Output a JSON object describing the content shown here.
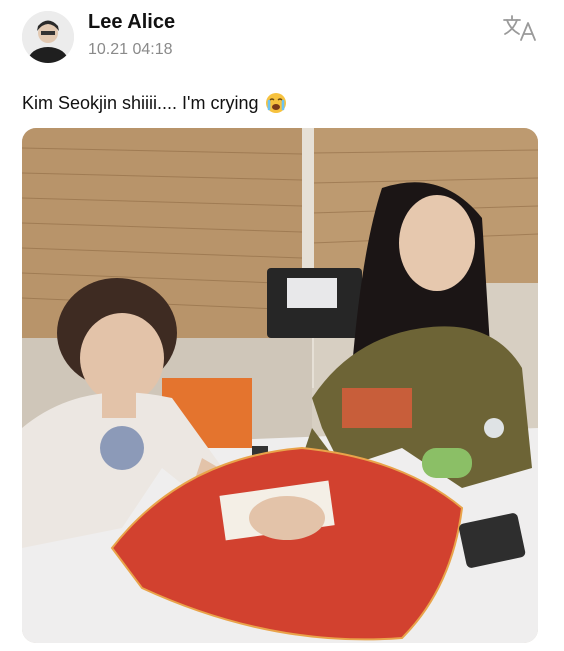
{
  "post": {
    "author_name": "Lee Alice",
    "timestamp": "10.21 04:18",
    "text": "Kim Seokjin shiiii.... I'm crying",
    "emoji": "loudly-crying-face-icon"
  },
  "actions": {
    "translate_icon": "translate-icon"
  },
  "colors": {
    "name": "#111111",
    "timestamp": "#8a8a8a",
    "cushion": "#d2412f",
    "wall_mat": "#b8946a"
  }
}
